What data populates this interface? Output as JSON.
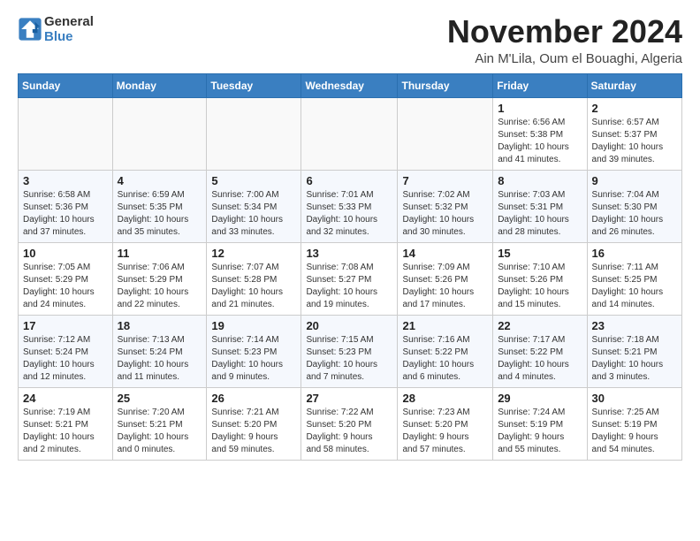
{
  "header": {
    "logo_line1": "General",
    "logo_line2": "Blue",
    "month_title": "November 2024",
    "subtitle": "Ain M'Lila, Oum el Bouaghi, Algeria"
  },
  "weekdays": [
    "Sunday",
    "Monday",
    "Tuesday",
    "Wednesday",
    "Thursday",
    "Friday",
    "Saturday"
  ],
  "weeks": [
    [
      {
        "day": "",
        "info": ""
      },
      {
        "day": "",
        "info": ""
      },
      {
        "day": "",
        "info": ""
      },
      {
        "day": "",
        "info": ""
      },
      {
        "day": "",
        "info": ""
      },
      {
        "day": "1",
        "info": "Sunrise: 6:56 AM\nSunset: 5:38 PM\nDaylight: 10 hours\nand 41 minutes."
      },
      {
        "day": "2",
        "info": "Sunrise: 6:57 AM\nSunset: 5:37 PM\nDaylight: 10 hours\nand 39 minutes."
      }
    ],
    [
      {
        "day": "3",
        "info": "Sunrise: 6:58 AM\nSunset: 5:36 PM\nDaylight: 10 hours\nand 37 minutes."
      },
      {
        "day": "4",
        "info": "Sunrise: 6:59 AM\nSunset: 5:35 PM\nDaylight: 10 hours\nand 35 minutes."
      },
      {
        "day": "5",
        "info": "Sunrise: 7:00 AM\nSunset: 5:34 PM\nDaylight: 10 hours\nand 33 minutes."
      },
      {
        "day": "6",
        "info": "Sunrise: 7:01 AM\nSunset: 5:33 PM\nDaylight: 10 hours\nand 32 minutes."
      },
      {
        "day": "7",
        "info": "Sunrise: 7:02 AM\nSunset: 5:32 PM\nDaylight: 10 hours\nand 30 minutes."
      },
      {
        "day": "8",
        "info": "Sunrise: 7:03 AM\nSunset: 5:31 PM\nDaylight: 10 hours\nand 28 minutes."
      },
      {
        "day": "9",
        "info": "Sunrise: 7:04 AM\nSunset: 5:30 PM\nDaylight: 10 hours\nand 26 minutes."
      }
    ],
    [
      {
        "day": "10",
        "info": "Sunrise: 7:05 AM\nSunset: 5:29 PM\nDaylight: 10 hours\nand 24 minutes."
      },
      {
        "day": "11",
        "info": "Sunrise: 7:06 AM\nSunset: 5:29 PM\nDaylight: 10 hours\nand 22 minutes."
      },
      {
        "day": "12",
        "info": "Sunrise: 7:07 AM\nSunset: 5:28 PM\nDaylight: 10 hours\nand 21 minutes."
      },
      {
        "day": "13",
        "info": "Sunrise: 7:08 AM\nSunset: 5:27 PM\nDaylight: 10 hours\nand 19 minutes."
      },
      {
        "day": "14",
        "info": "Sunrise: 7:09 AM\nSunset: 5:26 PM\nDaylight: 10 hours\nand 17 minutes."
      },
      {
        "day": "15",
        "info": "Sunrise: 7:10 AM\nSunset: 5:26 PM\nDaylight: 10 hours\nand 15 minutes."
      },
      {
        "day": "16",
        "info": "Sunrise: 7:11 AM\nSunset: 5:25 PM\nDaylight: 10 hours\nand 14 minutes."
      }
    ],
    [
      {
        "day": "17",
        "info": "Sunrise: 7:12 AM\nSunset: 5:24 PM\nDaylight: 10 hours\nand 12 minutes."
      },
      {
        "day": "18",
        "info": "Sunrise: 7:13 AM\nSunset: 5:24 PM\nDaylight: 10 hours\nand 11 minutes."
      },
      {
        "day": "19",
        "info": "Sunrise: 7:14 AM\nSunset: 5:23 PM\nDaylight: 10 hours\nand 9 minutes."
      },
      {
        "day": "20",
        "info": "Sunrise: 7:15 AM\nSunset: 5:23 PM\nDaylight: 10 hours\nand 7 minutes."
      },
      {
        "day": "21",
        "info": "Sunrise: 7:16 AM\nSunset: 5:22 PM\nDaylight: 10 hours\nand 6 minutes."
      },
      {
        "day": "22",
        "info": "Sunrise: 7:17 AM\nSunset: 5:22 PM\nDaylight: 10 hours\nand 4 minutes."
      },
      {
        "day": "23",
        "info": "Sunrise: 7:18 AM\nSunset: 5:21 PM\nDaylight: 10 hours\nand 3 minutes."
      }
    ],
    [
      {
        "day": "24",
        "info": "Sunrise: 7:19 AM\nSunset: 5:21 PM\nDaylight: 10 hours\nand 2 minutes."
      },
      {
        "day": "25",
        "info": "Sunrise: 7:20 AM\nSunset: 5:21 PM\nDaylight: 10 hours\nand 0 minutes."
      },
      {
        "day": "26",
        "info": "Sunrise: 7:21 AM\nSunset: 5:20 PM\nDaylight: 9 hours\nand 59 minutes."
      },
      {
        "day": "27",
        "info": "Sunrise: 7:22 AM\nSunset: 5:20 PM\nDaylight: 9 hours\nand 58 minutes."
      },
      {
        "day": "28",
        "info": "Sunrise: 7:23 AM\nSunset: 5:20 PM\nDaylight: 9 hours\nand 57 minutes."
      },
      {
        "day": "29",
        "info": "Sunrise: 7:24 AM\nSunset: 5:19 PM\nDaylight: 9 hours\nand 55 minutes."
      },
      {
        "day": "30",
        "info": "Sunrise: 7:25 AM\nSunset: 5:19 PM\nDaylight: 9 hours\nand 54 minutes."
      }
    ]
  ]
}
